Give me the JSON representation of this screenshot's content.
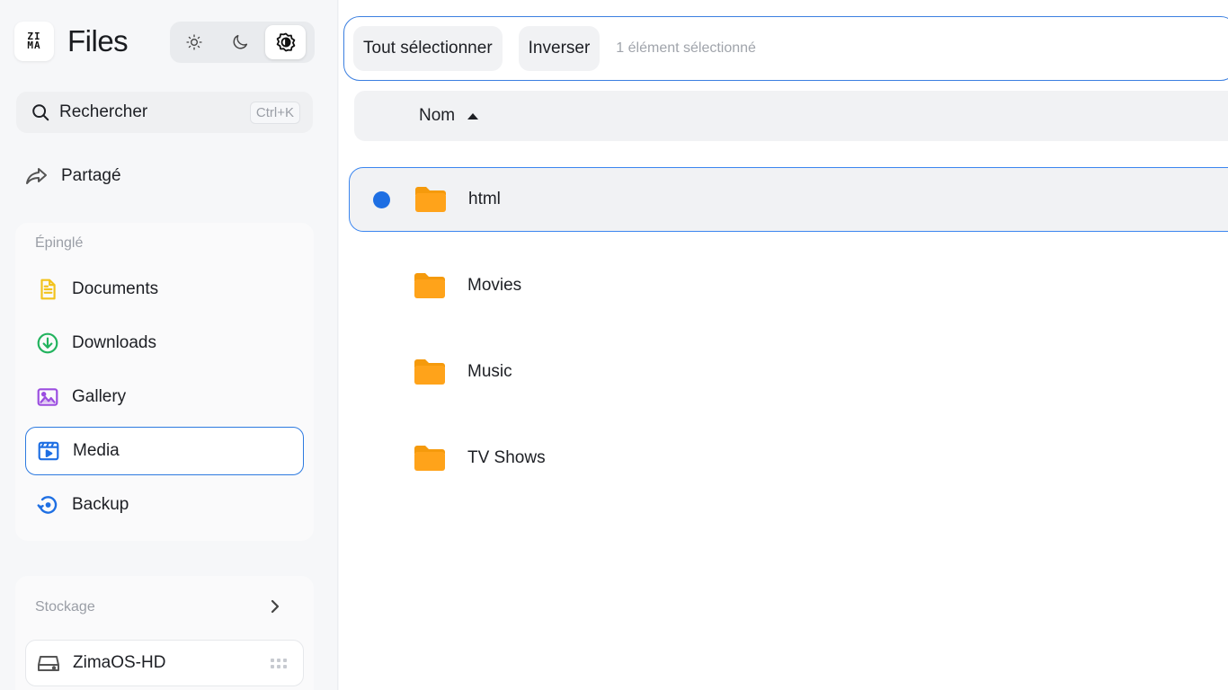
{
  "app": {
    "logo_top": "ZI",
    "logo_bottom": "MA",
    "title": "Files"
  },
  "theme": {
    "options": [
      "light-icon",
      "dark-icon",
      "auto-icon"
    ],
    "selected": "auto"
  },
  "search": {
    "label": "Rechercher",
    "shortcut": "Ctrl+K"
  },
  "shared": {
    "label": "Partagé"
  },
  "pinned": {
    "heading": "Épinglé",
    "items": [
      {
        "label": "Documents",
        "icon": "document-icon",
        "color": "#f2c21b"
      },
      {
        "label": "Downloads",
        "icon": "download-icon",
        "color": "#22b35e"
      },
      {
        "label": "Gallery",
        "icon": "gallery-icon",
        "color": "#9b4de0"
      },
      {
        "label": "Media",
        "icon": "media-icon",
        "color": "#1e6fe3"
      },
      {
        "label": "Backup",
        "icon": "backup-icon",
        "color": "#1e6fe3"
      }
    ],
    "active": "Media"
  },
  "storage": {
    "heading": "Stockage",
    "drives": [
      {
        "label": "ZimaOS-HD",
        "icon": "drive-icon"
      }
    ]
  },
  "toolbar": {
    "select_all": "Tout sélectionner",
    "invert": "Inverser",
    "status": "1 élément sélectionné"
  },
  "table": {
    "column_name": "Nom",
    "sort": "ascending",
    "rows": [
      {
        "name": "html",
        "selected": true
      },
      {
        "name": "Movies",
        "selected": false
      },
      {
        "name": "Music",
        "selected": false
      },
      {
        "name": "TV Shows",
        "selected": false
      }
    ]
  },
  "colors": {
    "accent": "#2d7ae0",
    "folder": "#ffa31a",
    "selected_dot": "#1e6fe3"
  }
}
